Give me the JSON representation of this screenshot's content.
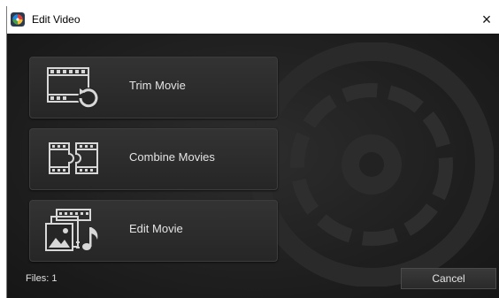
{
  "window": {
    "title": "Edit Video",
    "close_glyph": "×",
    "app_icon": "app-icon"
  },
  "actions": [
    {
      "label": "Trim Movie",
      "icon": "trim-movie-icon"
    },
    {
      "label": "Combine Movies",
      "icon": "combine-movies-icon"
    },
    {
      "label": "Edit Movie",
      "icon": "edit-movie-icon"
    }
  ],
  "footer": {
    "files_label": "Files: 1",
    "cancel_label": "Cancel"
  },
  "colors": {
    "background": "#1d1d1d",
    "button": "#2d2d2d",
    "text": "#e4e4e4",
    "icon": "#d8d8d8"
  }
}
